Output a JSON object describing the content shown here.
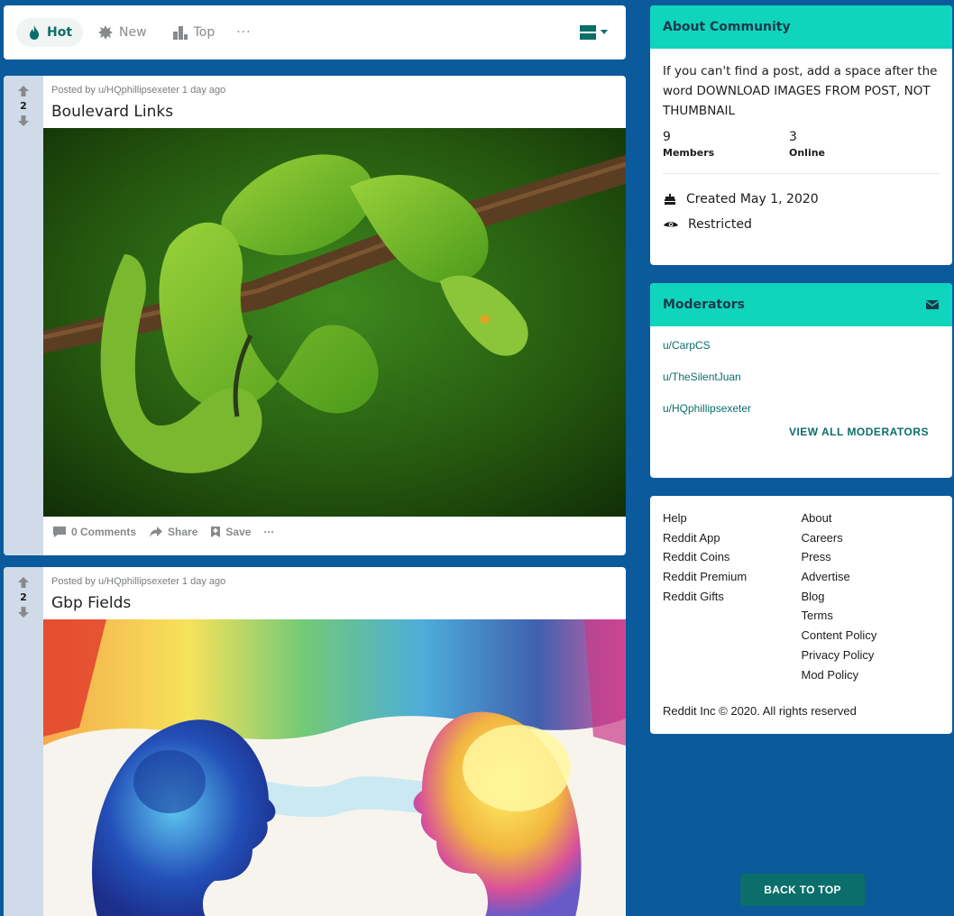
{
  "sort": {
    "hot": "Hot",
    "new": "New",
    "top": "Top",
    "more": "···"
  },
  "posts": [
    {
      "votes": "2",
      "meta": "Posted by u/HQphillipsexeter 1 day ago",
      "title": "Boulevard Links",
      "comments": "0 Comments",
      "share": "Share",
      "save": "Save",
      "more": "···"
    },
    {
      "votes": "2",
      "meta": "Posted by u/HQphillipsexeter 1 day ago",
      "title": "Gbp Fields"
    }
  ],
  "about": {
    "heading": "About Community",
    "description": "If you can't find a post, add a space after the word DOWNLOAD IMAGES FROM POST, NOT THUMBNAIL",
    "members_count": "9",
    "members_label": "Members",
    "online_count": "3",
    "online_label": "Online",
    "created": "Created May 1, 2020",
    "restricted": "Restricted"
  },
  "moderators": {
    "heading": "Moderators",
    "list": [
      "u/CarpCS",
      "u/TheSilentJuan",
      "u/HQphillipsexeter"
    ],
    "view_all": "VIEW ALL MODERATORS"
  },
  "footer": {
    "col1": [
      "Help",
      "Reddit App",
      "Reddit Coins",
      "Reddit Premium",
      "Reddit Gifts"
    ],
    "col2": [
      "About",
      "Careers",
      "Press",
      "Advertise",
      "Blog",
      "Terms",
      "Content Policy",
      "Privacy Policy",
      "Mod Policy"
    ],
    "copyright": "Reddit Inc © 2020. All rights reserved"
  },
  "back_to_top": "BACK TO TOP",
  "colors": {
    "background": "#0a5a9c",
    "accent": "#0fd5bc",
    "link": "#0b6e6a"
  }
}
